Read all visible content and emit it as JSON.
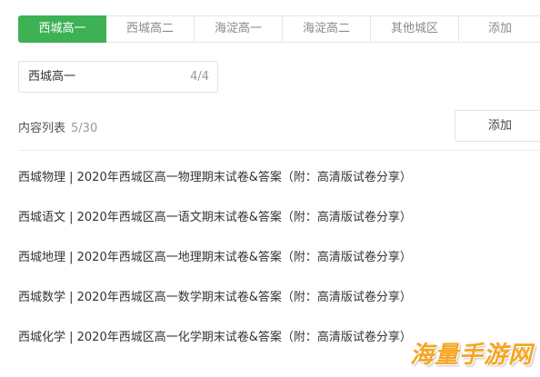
{
  "tabs": [
    {
      "label": "西城高一",
      "active": true
    },
    {
      "label": "西城高二",
      "active": false
    },
    {
      "label": "海淀高一",
      "active": false
    },
    {
      "label": "海淀高二",
      "active": false
    },
    {
      "label": "其他城区",
      "active": false
    },
    {
      "label": "添加",
      "active": false
    }
  ],
  "name_field": {
    "value": "西城高一",
    "count": "4/4"
  },
  "list": {
    "title": "内容列表",
    "count": "5/30",
    "add_label": "添加",
    "items": [
      "西城物理 | 2020年西城区高一物理期末试卷&答案（附：高清版试卷分享）",
      "西城语文 | 2020年西城区高一语文期末试卷&答案（附：高清版试卷分享）",
      "西城地理 | 2020年西城区高一地理期末试卷&答案（附：高清版试卷分享）",
      "西城数学 | 2020年西城区高一数学期末试卷&答案（附：高清版试卷分享）",
      "西城化学 | 2020年西城区高一化学期末试卷&答案（附：高清版试卷分享）"
    ]
  },
  "watermark": "海量手游网",
  "colors": {
    "accent": "#3db154",
    "border": "#e5e5e5",
    "muted_text": "#999999"
  }
}
